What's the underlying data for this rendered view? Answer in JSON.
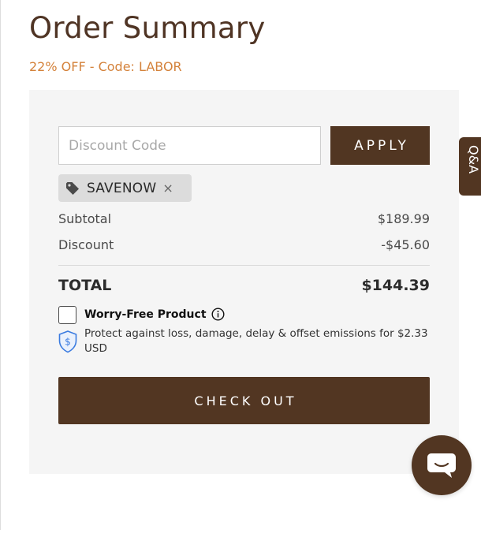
{
  "order_summary": {
    "title": "Order Summary",
    "promo_text": "22% OFF - Code: LABOR"
  },
  "discount": {
    "placeholder": "Discount Code",
    "apply_label": "APPLY",
    "applied_code": "SAVENOW",
    "remove_glyph": "×"
  },
  "totals": {
    "subtotal_label": "Subtotal",
    "subtotal_value": "$189.99",
    "discount_label": "Discount",
    "discount_value": "-$45.60",
    "total_label": "TOTAL",
    "total_value": "$144.39"
  },
  "protection": {
    "title": "Worry-Free Product",
    "description": "Protect against loss, damage, delay & offset emissions for $2.33 USD",
    "checked": false
  },
  "checkout": {
    "label": "CHECK OUT"
  },
  "side_tab": {
    "label": "Q&A"
  },
  "colors": {
    "brand_brown": "#523622",
    "promo_orange": "#d4823b",
    "panel_gray": "#f5f5f5",
    "shield_blue": "#3a7be0"
  },
  "icons": {
    "tag": "tag-icon",
    "remove": "close-icon",
    "info": "info-icon",
    "shield": "shield-dollar-icon",
    "chat": "chat-bubble-icon"
  }
}
